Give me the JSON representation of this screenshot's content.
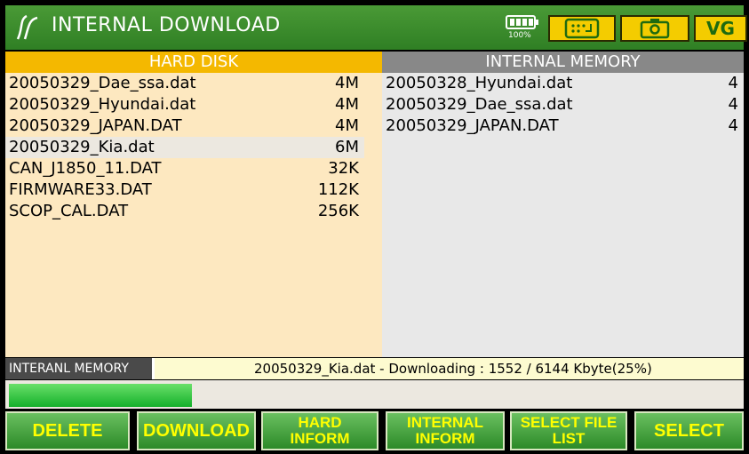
{
  "titlebar": {
    "title": "INTERNAL DOWNLOAD",
    "battery_label": "100%",
    "vg_label": "VG",
    "icons": [
      "app-logo-icon",
      "battery-icon",
      "keyboard-icon",
      "camera-icon"
    ]
  },
  "panels": {
    "hard_disk": {
      "header": "HARD DISK",
      "selected_index": 3,
      "files": [
        {
          "name": "20050329_Dae_ssa.dat",
          "size": "4M"
        },
        {
          "name": "20050329_Hyundai.dat",
          "size": "4M"
        },
        {
          "name": "20050329_JAPAN.DAT",
          "size": "4M"
        },
        {
          "name": "20050329_Kia.dat",
          "size": "6M"
        },
        {
          "name": "CAN_J1850_11.DAT",
          "size": "32K"
        },
        {
          "name": "FIRMWARE33.DAT",
          "size": "112K"
        },
        {
          "name": "SCOP_CAL.DAT",
          "size": "256K"
        }
      ]
    },
    "internal_memory": {
      "header": "INTERNAL MEMORY",
      "files": [
        {
          "name": "20050328_Hyundai.dat",
          "size": "4"
        },
        {
          "name": "20050329_Dae_ssa.dat",
          "size": "4"
        },
        {
          "name": "20050329_JAPAN.DAT",
          "size": "4"
        }
      ]
    }
  },
  "status": {
    "label": "INTERANL MEMORY",
    "message": "20050329_Kia.dat - Downloading : 1552 / 6144 Kbyte(25%)",
    "progress_fraction": 0.25
  },
  "buttons": {
    "delete": "DELETE",
    "download": "DOWNLOAD",
    "hard_inform": [
      "HARD",
      "INFORM"
    ],
    "internal_inform": [
      "INTERNAL",
      "INFORM"
    ],
    "select_file_list": [
      "SELECT FILE",
      "LIST"
    ],
    "select": "SELECT"
  },
  "colors": {
    "titlebar": "#3a8a2c",
    "hard_disk_header": "#f4b800",
    "internal_memory_header": "#888888",
    "button_text": "#ffff00",
    "progress": "#22c83a"
  }
}
